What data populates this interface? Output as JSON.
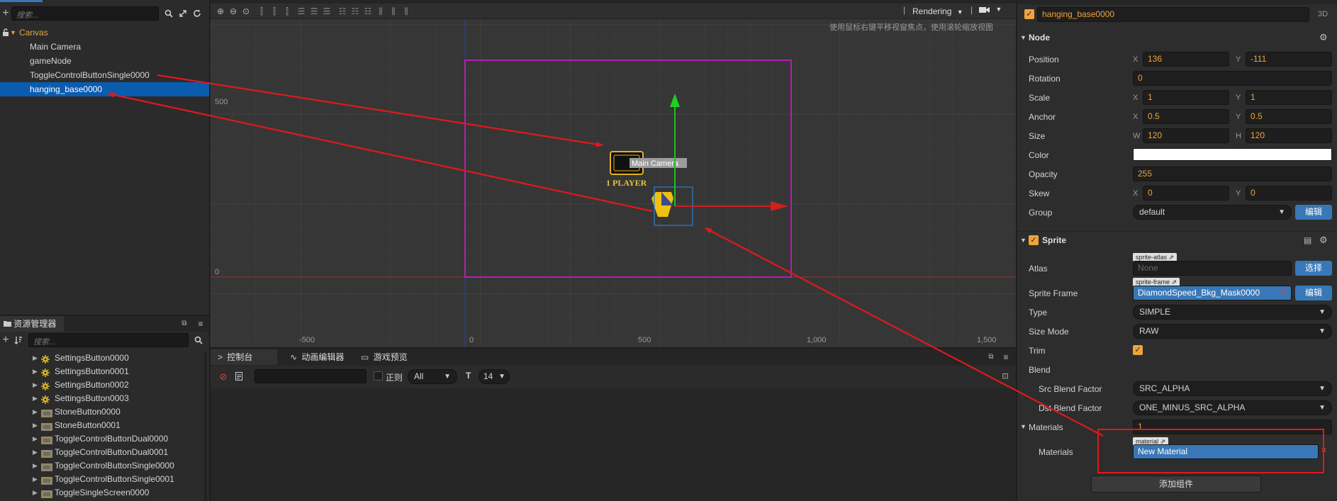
{
  "hierarchy": {
    "search_placeholder": "搜索...",
    "items": [
      {
        "label": "Canvas"
      },
      {
        "label": "Main Camera"
      },
      {
        "label": "gameNode"
      },
      {
        "label": "ToggleControlButtonSingle0000"
      },
      {
        "label": "hanging_base0000"
      }
    ]
  },
  "assets": {
    "tab_label": "资源管理器",
    "search_placeholder": "搜索...",
    "items": [
      {
        "label": "SettingsButton0000",
        "icon": "gear-icon"
      },
      {
        "label": "SettingsButton0001",
        "icon": "gear-icon"
      },
      {
        "label": "SettingsButton0002",
        "icon": "gear-icon"
      },
      {
        "label": "SettingsButton0003",
        "icon": "gear-icon"
      },
      {
        "label": "StoneButton0000",
        "icon": "image-icon"
      },
      {
        "label": "StoneButton0001",
        "icon": "image-icon"
      },
      {
        "label": "ToggleControlButtonDual0000",
        "icon": "image-icon"
      },
      {
        "label": "ToggleControlButtonDual0001",
        "icon": "image-icon"
      },
      {
        "label": "ToggleControlButtonSingle0000",
        "icon": "image-icon"
      },
      {
        "label": "ToggleControlButtonSingle0001",
        "icon": "image-icon"
      },
      {
        "label": "ToggleSingleScreen0000",
        "icon": "image-icon"
      }
    ]
  },
  "scene": {
    "rendering_label": "Rendering",
    "hint": "使用鼠标右键平移视窗焦点，使用滚轮缩放视图",
    "camera_label": "Main Camera",
    "player_label": "1 PLAYER",
    "ruler": {
      "y_labels": [
        "500",
        "0"
      ],
      "x_labels": [
        "-500",
        "0",
        "500",
        "1,000",
        "1,500"
      ]
    }
  },
  "console": {
    "tabs": [
      {
        "label": "控制台"
      },
      {
        "label": "动画编辑器"
      },
      {
        "label": "游戏预览"
      }
    ],
    "regex_label": "正则",
    "filter_value": "All",
    "font_size_value": "14"
  },
  "inspector": {
    "node_name": "hanging_base0000",
    "dim_label": "3D",
    "node_section": "Node",
    "position": {
      "label": "Position",
      "x": "136",
      "y": "-111"
    },
    "rotation": {
      "label": "Rotation",
      "value": "0"
    },
    "scale": {
      "label": "Scale",
      "x": "1",
      "y": "1"
    },
    "anchor": {
      "label": "Anchor",
      "x": "0.5",
      "y": "0.5"
    },
    "size": {
      "label": "Size",
      "w": "120",
      "h": "120"
    },
    "color": {
      "label": "Color",
      "value": "#ffffff"
    },
    "opacity": {
      "label": "Opacity",
      "value": "255"
    },
    "skew": {
      "label": "Skew",
      "x": "0",
      "y": "0"
    },
    "group": {
      "label": "Group",
      "value": "default",
      "edit_label": "编辑"
    },
    "axis_labels": {
      "x": "X",
      "y": "Y",
      "w": "W",
      "h": "H"
    },
    "sprite_section": "Sprite",
    "atlas": {
      "label": "Atlas",
      "tag": "sprite-atlas",
      "value": "None",
      "button": "选择"
    },
    "sprite_frame": {
      "label": "Sprite Frame",
      "tag": "sprite-frame",
      "value": "DiamondSpeed_Bkg_Mask0000",
      "button": "编辑"
    },
    "type": {
      "label": "Type",
      "value": "SIMPLE"
    },
    "size_mode": {
      "label": "Size Mode",
      "value": "RAW"
    },
    "trim": {
      "label": "Trim"
    },
    "blend": {
      "label": "Blend"
    },
    "src_blend": {
      "label": "Src Blend Factor",
      "value": "SRC_ALPHA"
    },
    "dst_blend": {
      "label": "Dst Blend Factor",
      "value": "ONE_MINUS_SRC_ALPHA"
    },
    "materials_count": {
      "label": "Materials",
      "value": "1"
    },
    "materials": {
      "label": "Materials",
      "tag": "material",
      "value": "New Material"
    },
    "add_component": "添加组件"
  },
  "colors": {
    "selection": "#0a5cae",
    "accent_orange": "#f0a33c",
    "annotation_red": "#e0191c",
    "canvas_border": "#b020b0",
    "button_blue": "#3878b8"
  }
}
